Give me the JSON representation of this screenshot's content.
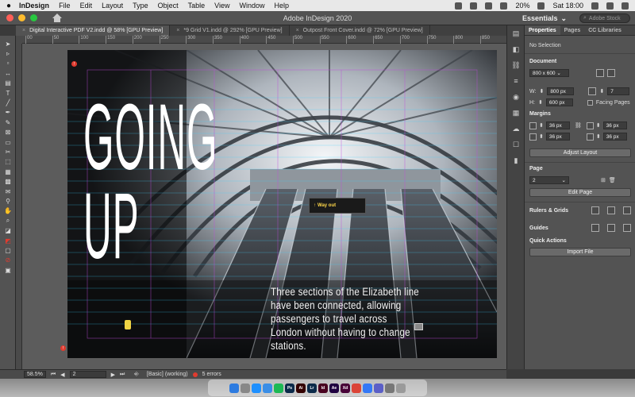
{
  "menubar": {
    "app_name": "InDesign",
    "items": [
      "File",
      "Edit",
      "Layout",
      "Type",
      "Object",
      "Table",
      "View",
      "Window",
      "Help"
    ],
    "battery": "20%",
    "clock": "Sat 18:00"
  },
  "window": {
    "title": "Adobe InDesign 2020",
    "workspace": "Essentials",
    "stock_search_placeholder": "Adobe Stock"
  },
  "tabs": [
    {
      "label": "Digital Interactive PDF V2.indd @ 58% [GPU Preview]",
      "active": true
    },
    {
      "label": "*9 Grid V1.indd @ 292% [GPU Preview]",
      "active": false
    },
    {
      "label": "Outpost Front Cover.indd @ 72% [GPU Preview]",
      "active": false
    }
  ],
  "ruler": {
    "ticks": [
      "00",
      "50",
      "100",
      "150",
      "200",
      "250",
      "300",
      "350",
      "400",
      "450",
      "500",
      "550",
      "600",
      "650",
      "700",
      "750",
      "800",
      "850"
    ]
  },
  "document": {
    "headline_line1": "GOING",
    "headline_line2": "UP",
    "body": "Three sections of the Elizabeth line have been connected, allowing passengers to travel across London without having to change stations.",
    "sign_text": "Way out"
  },
  "panel": {
    "tabs": [
      "Properties",
      "Pages",
      "CC Libraries"
    ],
    "selection": "No Selection",
    "document_label": "Document",
    "preset": "800 x 600",
    "width_label": "W:",
    "width": "800 px",
    "height_label": "H:",
    "height": "600 px",
    "pages_count": "7",
    "facing_pages": "Facing Pages",
    "margins_label": "Margins",
    "margin_top": "36 px",
    "margin_bottom": "36 px",
    "margin_inside": "36 px",
    "margin_outside": "36 px",
    "adjust_layout": "Adjust Layout",
    "page_label": "Page",
    "page_number": "2",
    "edit_page": "Edit Page",
    "rulers_grids": "Rulers & Grids",
    "guides": "Guides",
    "quick_actions": "Quick Actions",
    "import_file": "Import File"
  },
  "status": {
    "zoom": "58.5%",
    "page": "2",
    "style": "[Basic] (working)",
    "errors": "5 errors"
  },
  "dock": {
    "apps": [
      {
        "name": "finder",
        "label": "",
        "color": "#2d7be0"
      },
      {
        "name": "launchpad",
        "label": "",
        "color": "#888888"
      },
      {
        "name": "safari",
        "label": "",
        "color": "#1e90ff"
      },
      {
        "name": "mail",
        "label": "",
        "color": "#3a8ee6"
      },
      {
        "name": "spotify",
        "label": "",
        "color": "#1db954"
      },
      {
        "name": "photoshop",
        "label": "Ps",
        "color": "#0b2a4a"
      },
      {
        "name": "illustrator",
        "label": "Ai",
        "color": "#330000"
      },
      {
        "name": "lightroom",
        "label": "Lr",
        "color": "#0c2b4a"
      },
      {
        "name": "indesign",
        "label": "Id",
        "color": "#49021f"
      },
      {
        "name": "after-effects",
        "label": "Ae",
        "color": "#1f0040"
      },
      {
        "name": "xd",
        "label": "Xd",
        "color": "#470137"
      },
      {
        "name": "chrome",
        "label": "",
        "color": "#db4437"
      },
      {
        "name": "app-a",
        "label": "",
        "color": "#3478f6"
      },
      {
        "name": "app-b",
        "label": "",
        "color": "#5b5fc7"
      },
      {
        "name": "app-c",
        "label": "",
        "color": "#777777"
      },
      {
        "name": "trash",
        "label": "",
        "color": "#9a9a9a"
      }
    ]
  },
  "colors": {
    "accent": "#e03b2f",
    "guide": "#3fd0ff",
    "margin_guide": "#c14ae0"
  }
}
